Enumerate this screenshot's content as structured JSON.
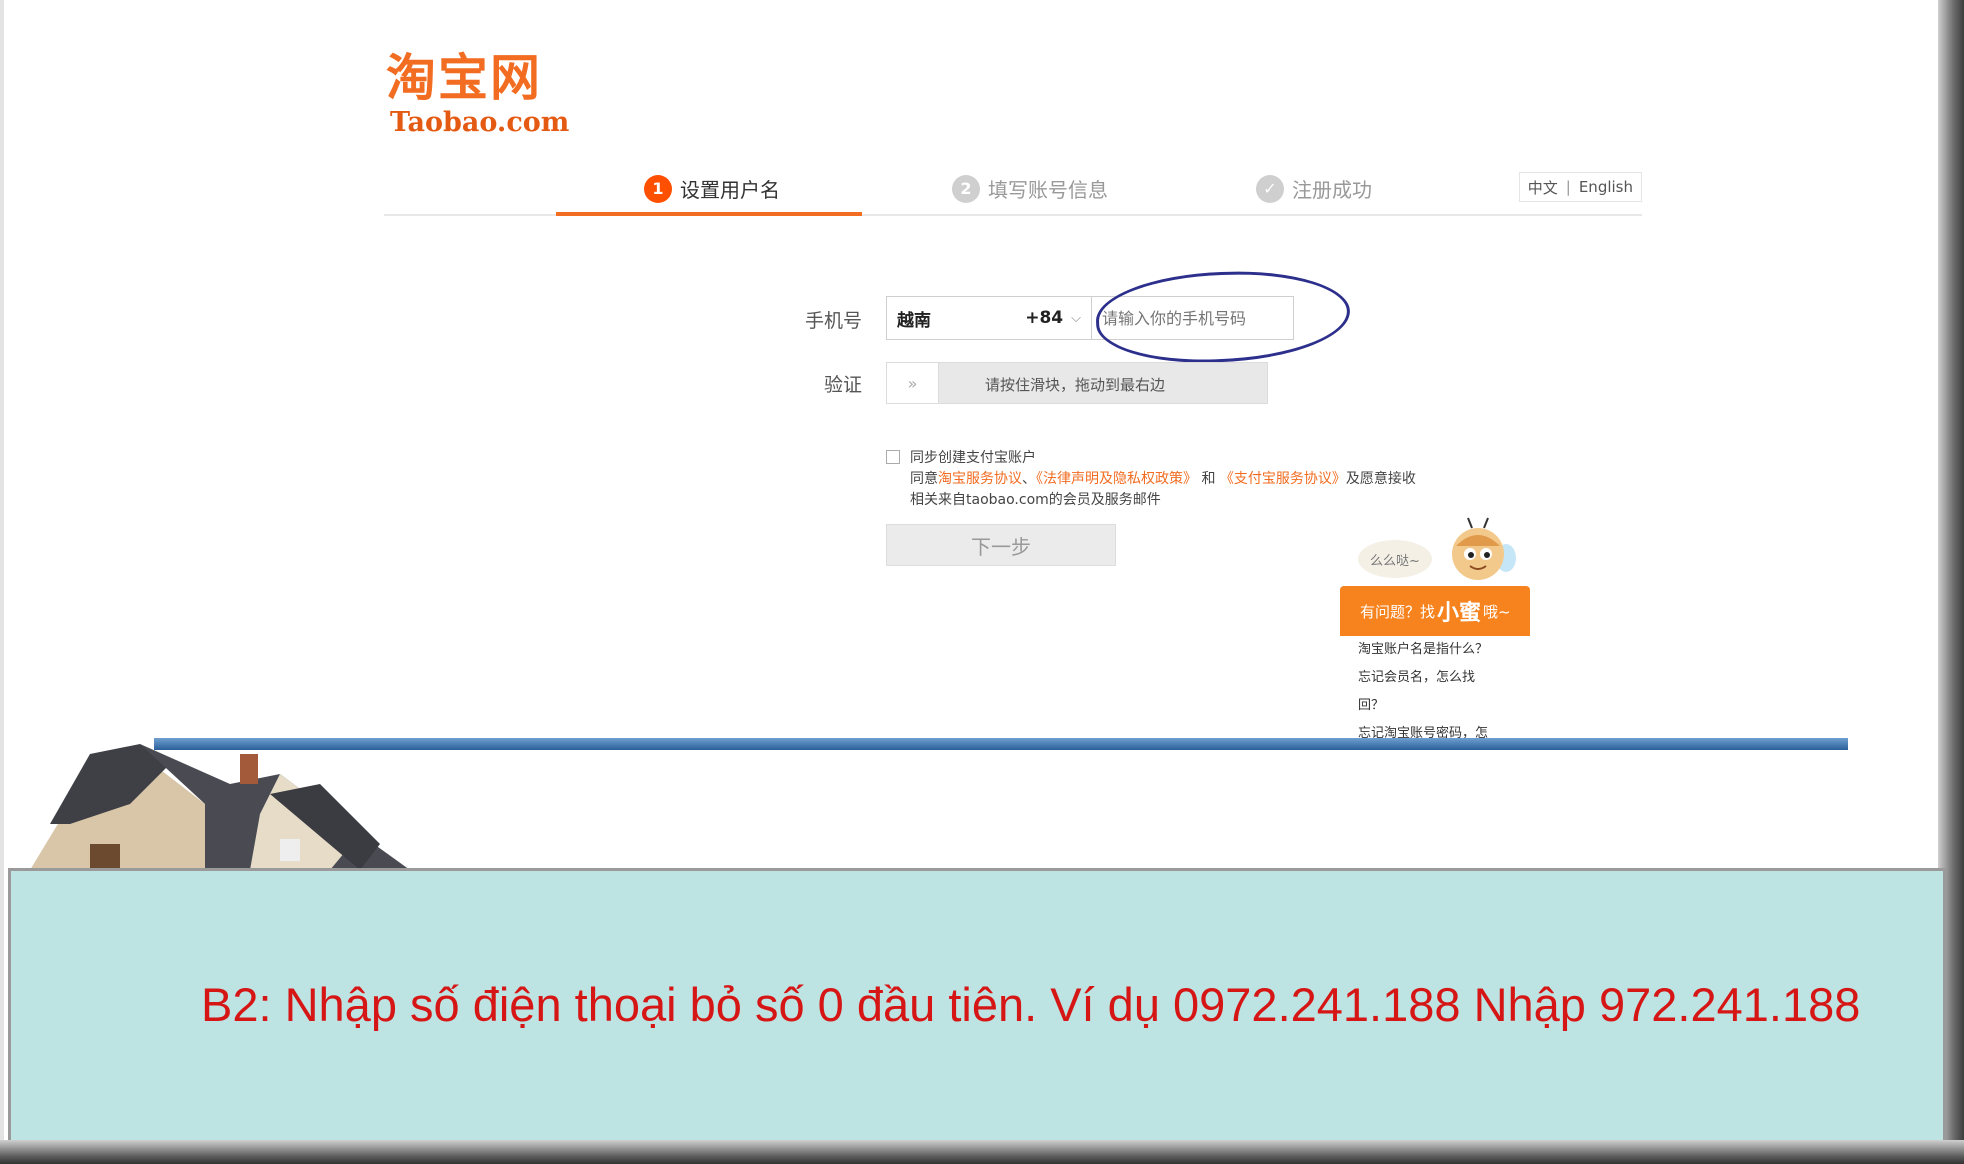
{
  "logo": {
    "chinese": "淘宝网",
    "domain": "Taobao.com"
  },
  "steps": [
    {
      "number": "1",
      "label": "设置用户名",
      "active": true
    },
    {
      "number": "2",
      "label": "填写账号信息",
      "active": false
    },
    {
      "number": "✓",
      "label": "注册成功",
      "active": false
    }
  ],
  "language": {
    "chinese": "中文",
    "separator": "|",
    "english": "English"
  },
  "form": {
    "phone_label": "手机号",
    "country": "越南",
    "country_code": "+84",
    "phone_placeholder": "请输入你的手机号码",
    "verify_label": "验证",
    "slider_handle": "»",
    "slider_text": "请按住滑块，拖动到最右边"
  },
  "agreement": {
    "line1": "同步创建支付宝账户",
    "line2_prefix": "同意",
    "link_service": "淘宝服务协议",
    "sep": "、",
    "link_legal": "《法律声明及隐私权政策》",
    "and": " 和 ",
    "link_alipay": "《支付宝服务协议》",
    "line2_suffix": "及愿意接收",
    "line3": "相关来自taobao.com的会员及服务邮件"
  },
  "next_button": "下一步",
  "helper": {
    "bubble": "么么哒~",
    "head_prefix": "有问题？找",
    "head_name": "小蜜",
    "head_suffix": "哦~",
    "items": [
      "淘宝账户名是指什么？",
      "忘记会员名，怎么找",
      "回？",
      "忘记淘宝账号密码，怎"
    ]
  },
  "caption": "B2: Nhập số điện thoại bỏ số 0 đầu tiên. Ví dụ 0972.241.188 Nhập 972.241.188",
  "colors": {
    "brand_orange": "#f26c21",
    "caption_bg": "#bde3e2",
    "caption_text": "#d61515",
    "annotation": "#2c2f8c"
  }
}
